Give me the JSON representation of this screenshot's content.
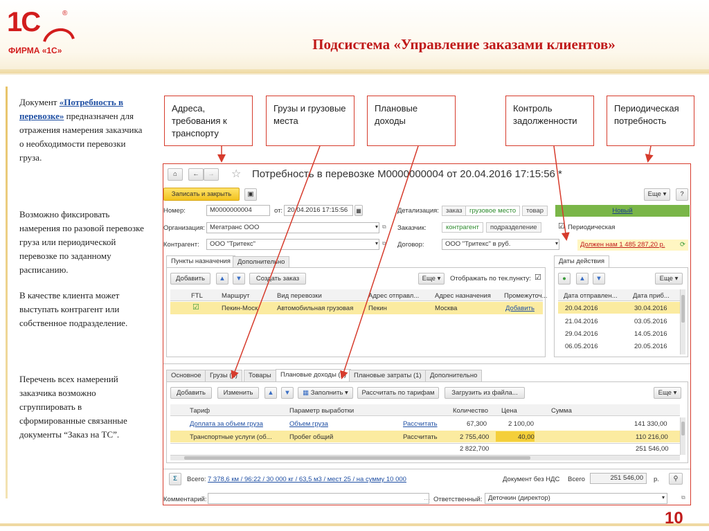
{
  "header": {
    "logo_text": "1С",
    "logo_sub": "ФИРМА «1С»",
    "logo_reg": "®",
    "title": "Подсистема «Управление заказами клиентов»"
  },
  "left_text": {
    "p1_pre": "Документ ",
    "p1_link": "«Потребность в перевозке»",
    "p1_post": " предназначен для отражения намерения заказчика о необходимости перевозки груза.",
    "p2": "Возможно фиксировать намерения по разовой перевозке груза или периодической перевозке по заданному расписанию.",
    "p3": "В качестве клиента может выступать контрагент или собственное подразделение.",
    "p4": "Перечень всех намерений заказчика возможно сгруппировать в сформированные связанные документы “Заказ на ТС”."
  },
  "callouts": [
    {
      "text": "Адреса, требования к транспорту"
    },
    {
      "text": "Грузы и грузовые места"
    },
    {
      "text": "Плановые доходы"
    },
    {
      "text": "Контроль задолженности"
    },
    {
      "text": "Периодическая потребность"
    }
  ],
  "window": {
    "title": "Потребность в перевозке М0000000004 от 20.04.2016 17:15:56 *",
    "save_close": "Записать и закрыть",
    "more": "Еще",
    "help": "?",
    "number_label": "Номер:",
    "number_value": "М0000000004",
    "from_label": "от:",
    "date_value": "20.04.2016 17:15:56",
    "detail_label": "Детализация:",
    "detail_opts": [
      "заказ",
      "грузовое место",
      "товар"
    ],
    "status": "Новый",
    "org_label": "Организация:",
    "org_value": "Мегатранс ООО",
    "customer_label": "Заказчик:",
    "customer_opts": [
      "контрагент",
      "подразделение"
    ],
    "periodic_label": "Периодическая",
    "contr_label": "Контрагент:",
    "contr_value": "ООО \"Тритекс\"",
    "contract_label": "Договор:",
    "contract_value": "ООО \"Тритекс\" в руб.",
    "debt": "Должен нам 1 485 287,20 р."
  },
  "dest": {
    "tabs": [
      "Пункты назначения",
      "Дополнительно"
    ],
    "add": "Добавить",
    "create_order": "Создать заказ",
    "more": "Еще",
    "show_label": "Отображать по тек.пункту:",
    "columns": [
      "FTL",
      "Маршрут",
      "Вид перевозки",
      "Адрес отправл...",
      "Адрес назначения",
      "Промежуточ..."
    ],
    "rows": [
      {
        "route": "Пекин-Моск",
        "kind": "Автомобильная грузовая",
        "from": "Пекин",
        "to": "Москва",
        "mid": "Добавить"
      }
    ]
  },
  "dates": {
    "tab": "Даты действия",
    "more": "Еще",
    "columns": [
      "Дата отправлен...",
      "Дата приб..."
    ],
    "rows": [
      [
        "20.04.2016",
        "30.04.2016"
      ],
      [
        "21.04.2016",
        "03.05.2016"
      ],
      [
        "29.04.2016",
        "14.05.2016"
      ],
      [
        "06.05.2016",
        "20.05.2016"
      ]
    ]
  },
  "bottom": {
    "tabs": [
      "Основное",
      "Грузы (1)",
      "Товары",
      "Плановые доходы (2)",
      "Плановые затраты (1)",
      "Дополнительно"
    ],
    "add": "Добавить",
    "change": "Изменить",
    "fill": "Заполнить",
    "calc_tariff": "Рассчитать по тарифам",
    "load_file": "Загрузить из файла...",
    "more": "Еще",
    "columns": [
      "Тариф",
      "Параметр выработки",
      "Количество",
      "Цена",
      "Сумма"
    ],
    "rows": [
      {
        "tariff": "Доплата за объем груза",
        "param": "Объем груза",
        "calc": "Рассчитать",
        "qty": "67,300",
        "price": "2 100,00",
        "sum": "141 330,00"
      },
      {
        "tariff": "Транспортные услуги (об...",
        "param": "Пробег общий",
        "calc": "Рассчитать",
        "qty": "2 755,400",
        "price": "40,00",
        "sum": "110 216,00"
      }
    ],
    "total_qty": "2 822,700",
    "total_sum": "251 546,00"
  },
  "footer": {
    "sigma": "Σ",
    "total_label": "Всего:",
    "total_link": "7 378,6 км / 96:22 / 30 000 кг / 63,5 м3 / мест 25 / на сумму 10 000",
    "vat_label": "Документ без НДС",
    "sum_label": "Всего",
    "sum_value": "251 546,00",
    "currency": "р.",
    "comment_label": "Комментарий:",
    "resp_label": "Ответственный:",
    "resp_value": "Деточкин (директор)"
  },
  "page_number": "10",
  "colors": {
    "accent": "#c01a1a",
    "callout_border": "#d63b2c",
    "save_btn": "#f4cf3a",
    "status_bg": "#7ab648",
    "selected_row": "#fbeba0"
  }
}
